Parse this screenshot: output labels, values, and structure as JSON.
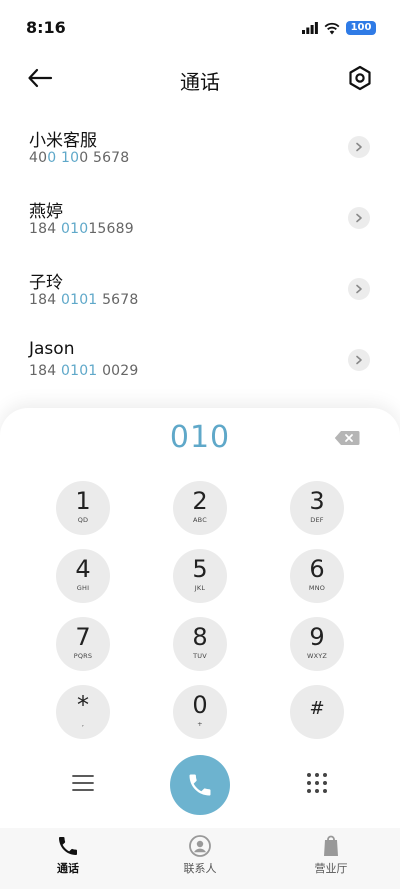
{
  "status_bar": {
    "time": "8:16",
    "battery": "100",
    "icons": [
      "signal-icon",
      "wifi-icon",
      "battery-icon"
    ]
  },
  "header": {
    "title": "通话",
    "back_icon": "back-arrow-icon",
    "settings_icon": "settings-icon"
  },
  "contacts": [
    {
      "name": "小米客服",
      "number_segments": [
        {
          "t": "40",
          "hl": false
        },
        {
          "t": "0 10",
          "hl": true
        },
        {
          "t": "0 5678",
          "hl": false
        }
      ]
    },
    {
      "name": "燕婷",
      "number_segments": [
        {
          "t": "184 ",
          "hl": false
        },
        {
          "t": "010",
          "hl": true
        },
        {
          "t": "15689",
          "hl": false
        }
      ]
    },
    {
      "name": "子玲",
      "number_segments": [
        {
          "t": "184 ",
          "hl": false
        },
        {
          "t": "0101",
          "hl": true
        },
        {
          "t": " 5678",
          "hl": false
        }
      ]
    },
    {
      "name": "Jason",
      "number_segments": [
        {
          "t": "184 ",
          "hl": false
        },
        {
          "t": "0101",
          "hl": true
        },
        {
          "t": " 0029",
          "hl": false
        }
      ]
    }
  ],
  "dialer": {
    "input": "010",
    "keys": [
      {
        "digit": "1",
        "letters": "QD"
      },
      {
        "digit": "2",
        "letters": "ABC"
      },
      {
        "digit": "3",
        "letters": "DEF"
      },
      {
        "digit": "4",
        "letters": "GHI"
      },
      {
        "digit": "5",
        "letters": "JKL"
      },
      {
        "digit": "6",
        "letters": "MNO"
      },
      {
        "digit": "7",
        "letters": "PQRS"
      },
      {
        "digit": "8",
        "letters": "TUV"
      },
      {
        "digit": "9",
        "letters": "WXYZ"
      },
      {
        "digit": "*",
        "letters": ","
      },
      {
        "digit": "0",
        "letters": "+"
      },
      {
        "digit": "#",
        "letters": ""
      }
    ]
  },
  "bottom_nav": {
    "items": [
      {
        "label": "通话",
        "active": true
      },
      {
        "label": "联系人",
        "active": false
      },
      {
        "label": "营业厅",
        "active": false
      }
    ]
  },
  "colors": {
    "accent": "#5fa8c9",
    "call_button": "#6db3cf",
    "battery": "#2f7be6",
    "key_bg": "#ebebeb"
  }
}
